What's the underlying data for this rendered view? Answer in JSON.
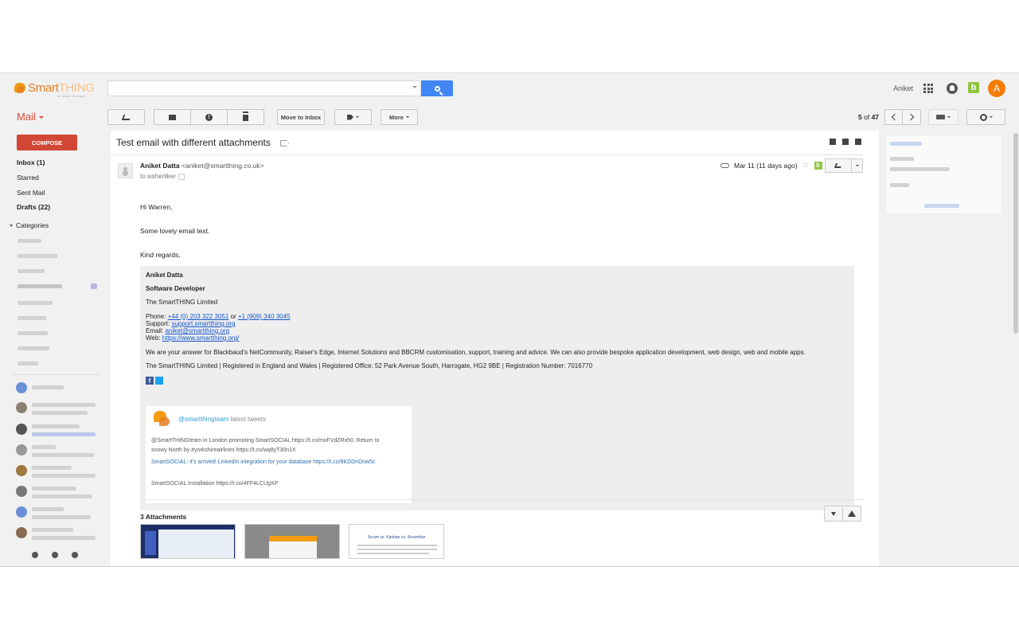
{
  "brand": {
    "name_main": "Smart",
    "name_accent": "THING",
    "tagline": "so smart, it's simple"
  },
  "search": {
    "placeholder": ""
  },
  "header": {
    "user_name": "Aniket",
    "avatar_letter": "A",
    "addon_badge": "b"
  },
  "toolbar": {
    "mail_label": "Mail",
    "move_to_inbox": "Move to Inbox",
    "more": "More",
    "pagination": {
      "current": "5",
      "of_label": "of",
      "total": "47"
    }
  },
  "sidebar": {
    "compose": "COMPOSE",
    "items": [
      {
        "label": "Inbox (1)",
        "bold": true
      },
      {
        "label": "Starred",
        "bold": false
      },
      {
        "label": "Sent Mail",
        "bold": false
      },
      {
        "label": "Drafts (22)",
        "bold": true
      }
    ],
    "categories": "Categories"
  },
  "message": {
    "subject": "Test email with different attachments",
    "sender_name": "Aniket Datta",
    "sender_email": "<aniket@smartthing.co.uk>",
    "to": "to wsherliker",
    "date": "Mar 11 (11 days ago)",
    "greeting": "Hi Warren,",
    "body": "Some lovely email text.",
    "closing": "Kind regards,"
  },
  "signature": {
    "name": "Aniket Datta",
    "role": "Software Developer",
    "company": "The SmartTHING Limited",
    "phone_label": "Phone:",
    "phone1": "+44 (0) 203 322 3051",
    "phone_or": "or",
    "phone2": "+1 (909) 340 3045",
    "support_label": "Support:",
    "support": "support.smartthing.org",
    "email_label": "Email:",
    "email": "aniket@smartthing.org",
    "web_label": "Web:",
    "web": "https://www.smartthing.org/",
    "pitch": "We are your answer for Blackbaud's NetCommunity, Raiser's Edge, Internet Solutions and BBCRM customisation, support, training and advice. We can also provide bespoke application development, web design, web and mobile apps.",
    "legal": "The SmartTHING Limited | Registered in England and Wales | Registered Office: 52 Park Avenue South, Harrogate, HG2 9BE | Registration Number: 7016770"
  },
  "tweets": {
    "handle": "@smartthingteam",
    "heading_suffix": "latest tweets",
    "lines": [
      "@SmartTHINGteam in London promoting SmartSOCIAL https://t.co/mxFVdZRxh0. Return to",
      "snowy North by #yorkshireairlines https://t.co/wq8yT30n1X",
      "SmartSOCIAL: it's arrived! LinkedIn integration for your database https://t.co/9KDDnDnw5c",
      "SmartSOCIAL Installation https://t.co/4FF4LCUgXP"
    ]
  },
  "attachments": {
    "title": "3 Attachments",
    "thumb3_title": "Scrum vs. Kanban vs. Scrumban"
  }
}
